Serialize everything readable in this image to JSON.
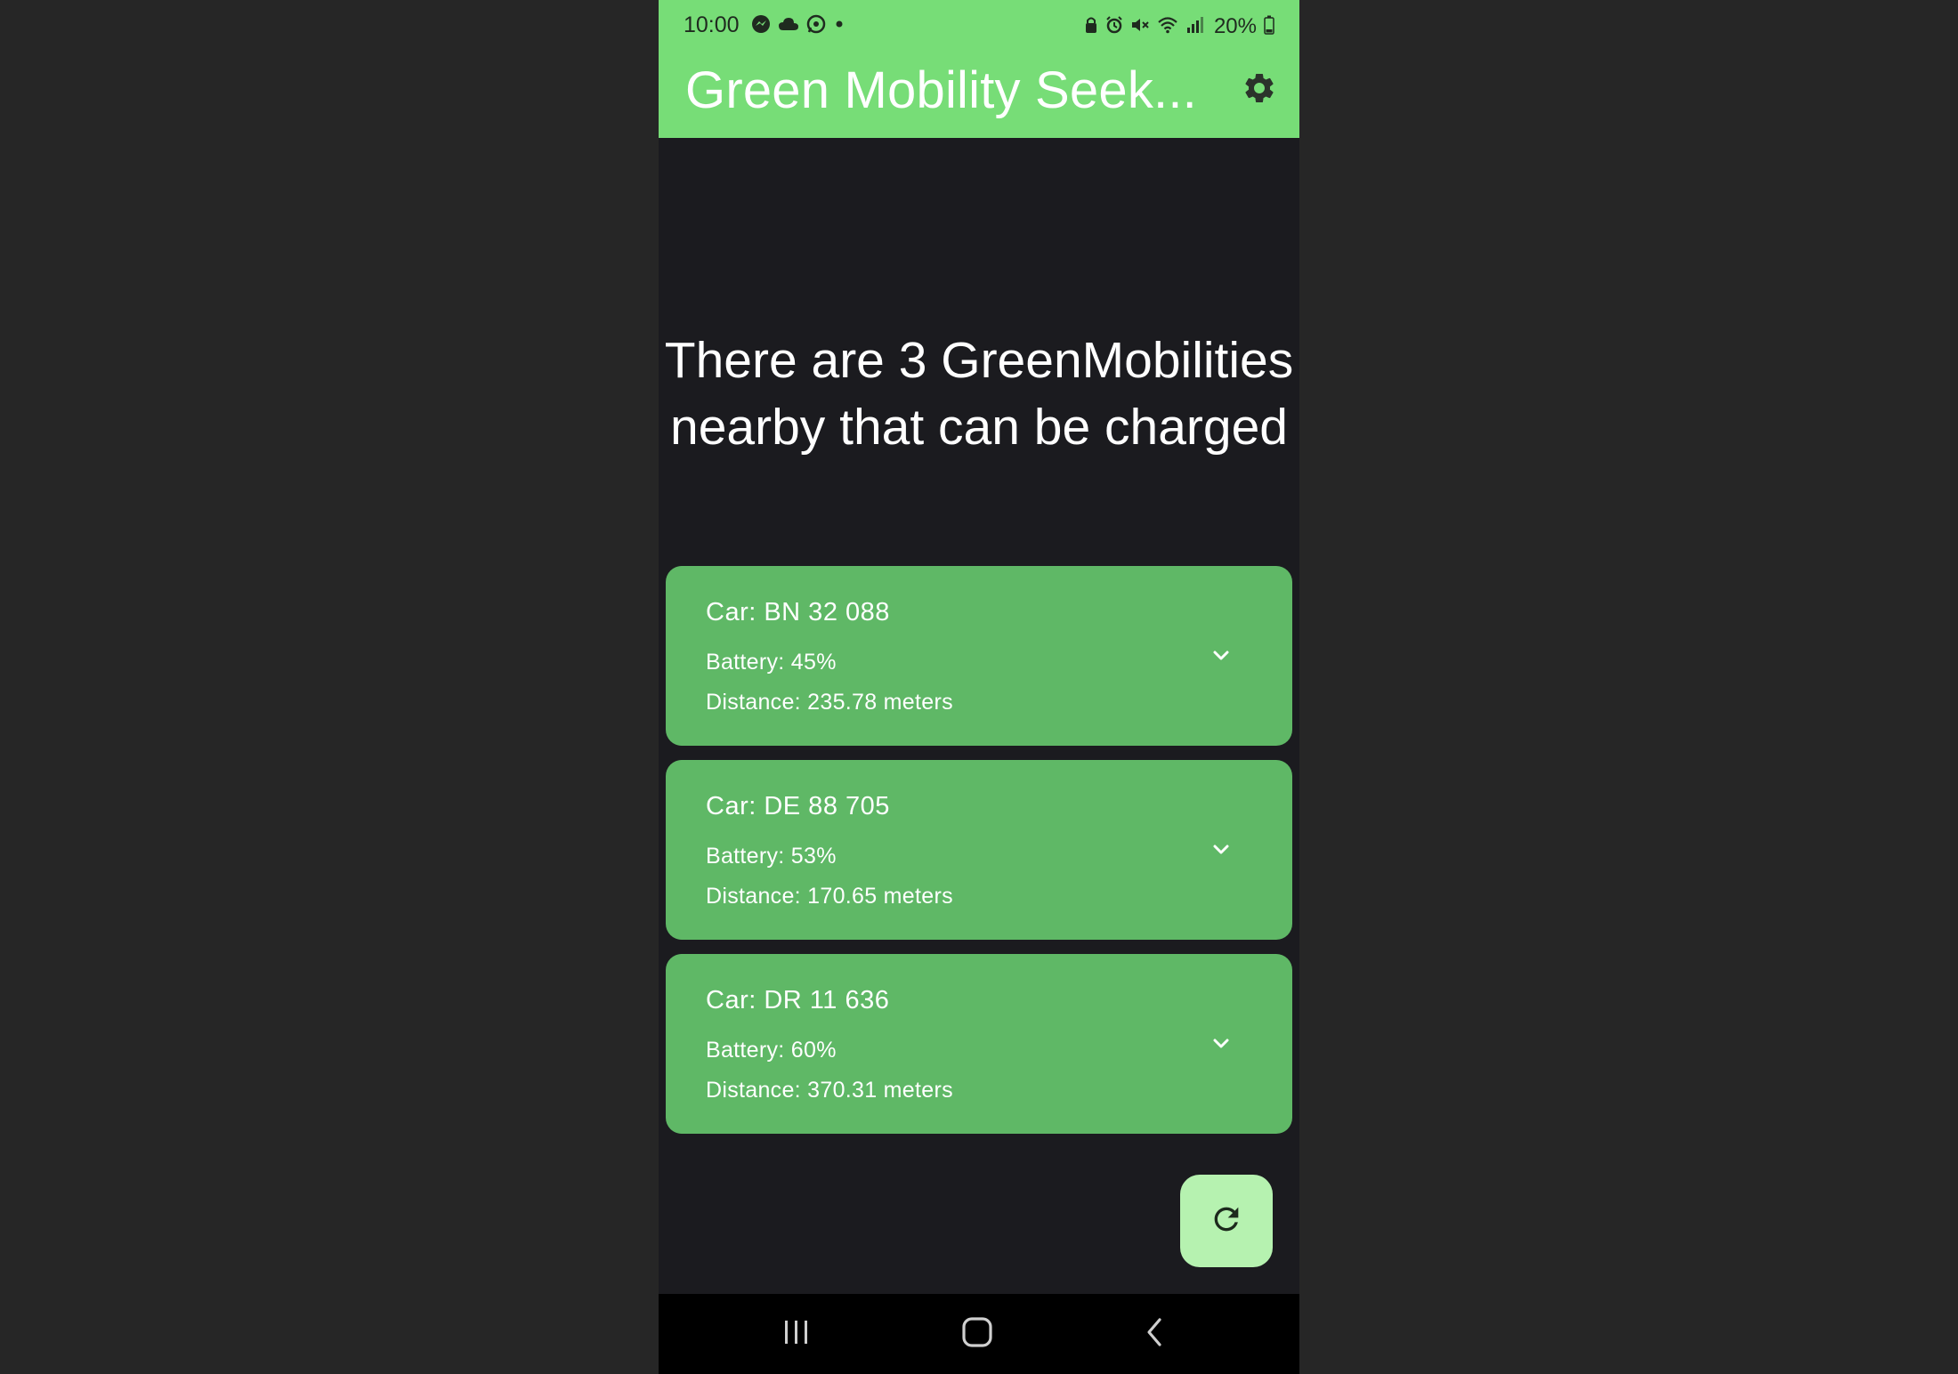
{
  "status_bar": {
    "time": "10:00",
    "battery_text": "20%",
    "left_icons": [
      "messenger-icon",
      "cloud-icon",
      "whatsapp-icon",
      "dot-icon"
    ],
    "right_icons": [
      "lock-icon",
      "alarm-icon",
      "mute-icon",
      "wifi-icon",
      "signal-icon",
      "battery-icon"
    ]
  },
  "app_bar": {
    "title": "Green Mobility Seek...",
    "settings_icon": "gear-icon",
    "background_color": "#77dd77"
  },
  "main": {
    "headline": "There are 3 GreenMobilities nearby that can be charged"
  },
  "cards": [
    {
      "title": "Car: BN 32 088",
      "battery": "Battery: 45%",
      "distance": "Distance: 235.78 meters"
    },
    {
      "title": "Car: DE 88 705",
      "battery": "Battery: 53%",
      "distance": "Distance: 170.65 meters"
    },
    {
      "title": "Car: DR 11 636",
      "battery": "Battery: 60%",
      "distance": "Distance: 370.31 meters"
    }
  ],
  "card_color": "#5fb866",
  "fab": {
    "icon": "refresh-icon",
    "color": "#b6f2b0"
  },
  "nav_bar": {
    "buttons": [
      "recent-apps-icon",
      "home-icon",
      "back-icon"
    ]
  }
}
